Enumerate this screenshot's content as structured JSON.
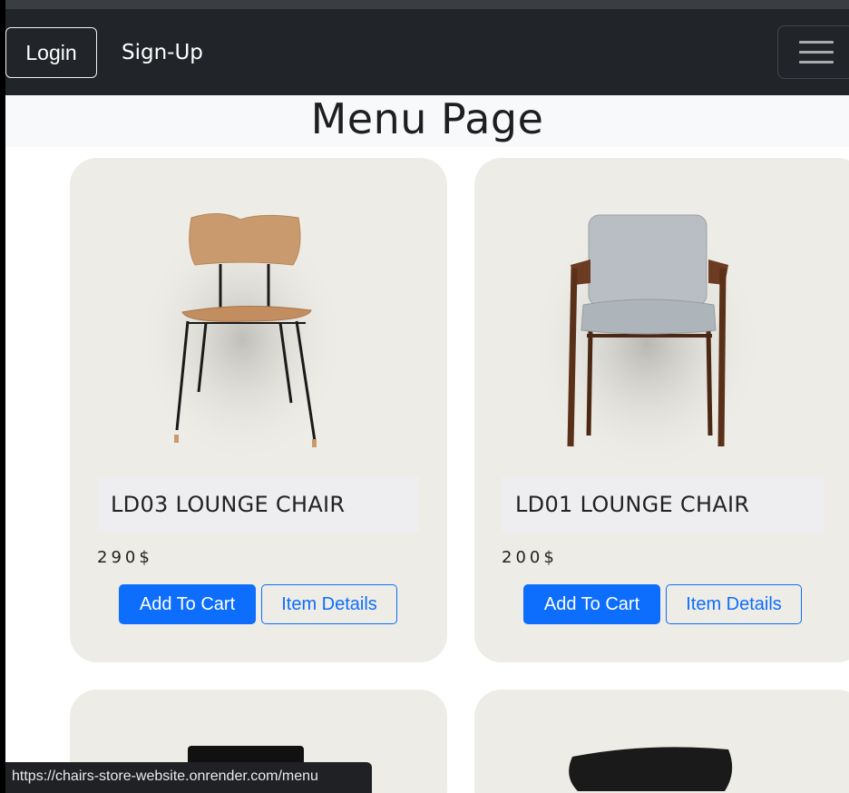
{
  "navbar": {
    "login_label": "Login",
    "signup_label": "Sign-Up",
    "menu_toggle_icon": "hamburger-icon"
  },
  "page": {
    "title": "Menu Page"
  },
  "products": [
    {
      "name": "LD03 LOUNGE CHAIR",
      "price": "290$",
      "add_label": "Add To Cart",
      "details_label": "Item Details",
      "image_icon": "wood-chair-image"
    },
    {
      "name": "LD01 LOUNGE CHAIR",
      "price": "200$",
      "add_label": "Add To Cart",
      "details_label": "Item Details",
      "image_icon": "upholstered-armchair-image"
    }
  ],
  "status_bar": {
    "url": "https://chairs-store-website.onrender.com/menu"
  },
  "colors": {
    "navbar_bg": "#212529",
    "card_bg": "#edece6",
    "primary": "#0d6efd"
  }
}
